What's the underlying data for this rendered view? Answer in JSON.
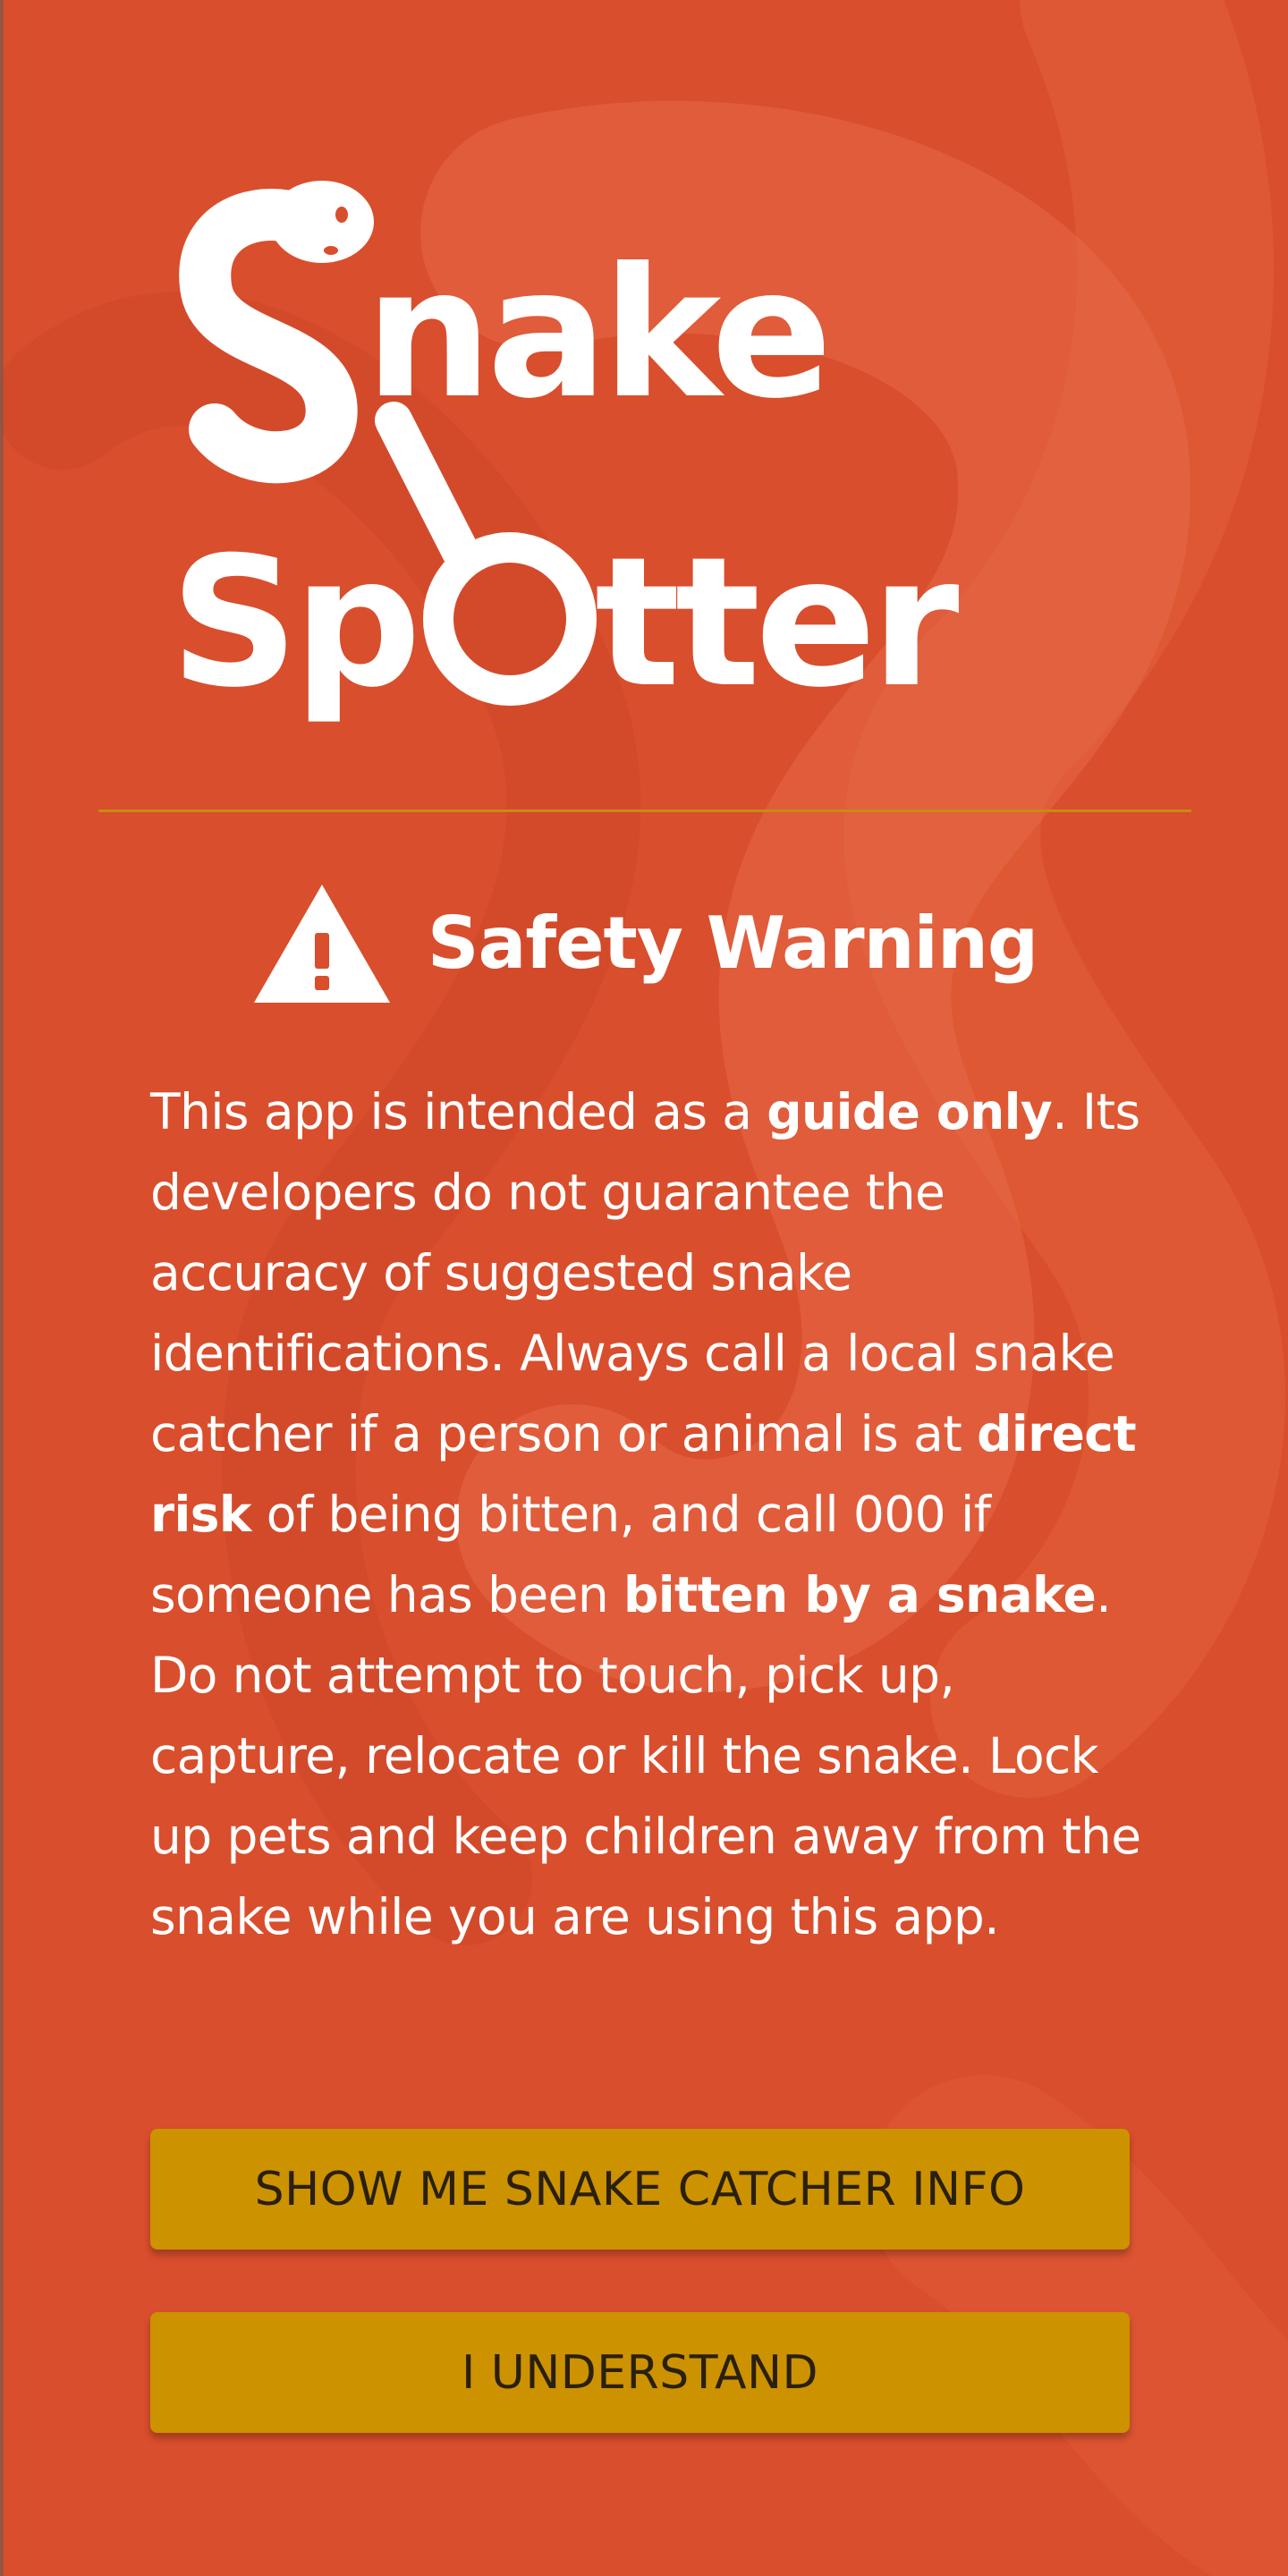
{
  "app": {
    "logo_line1": "Snake",
    "logo_line2": "Spotter"
  },
  "warning": {
    "icon": "warning-triangle-icon",
    "title": "Safety Warning",
    "segments": [
      {
        "text": "This app is intended as a ",
        "bold": false
      },
      {
        "text": "guide only",
        "bold": true
      },
      {
        "text": ". Its developers do not guarantee the accuracy of suggested snake identifications. Always call a local snake catcher if a person or animal is at ",
        "bold": false
      },
      {
        "text": "direct risk",
        "bold": true
      },
      {
        "text": " of being bitten, and call 000 if someone has been ",
        "bold": false
      },
      {
        "text": "bitten by a snake",
        "bold": true
      },
      {
        "text": ". Do not attempt to touch, pick up, capture, relocate or kill the snake. Lock up pets and keep children away from the snake while you are using this app.",
        "bold": false
      }
    ]
  },
  "buttons": {
    "catcher_label": "SHOW ME SNAKE CATCHER INFO",
    "understand_label": "I UNDERSTAND"
  },
  "colors": {
    "background": "#d94e2c",
    "accent": "#cc9200",
    "divider": "#c98a10",
    "text": "#ffffff"
  }
}
